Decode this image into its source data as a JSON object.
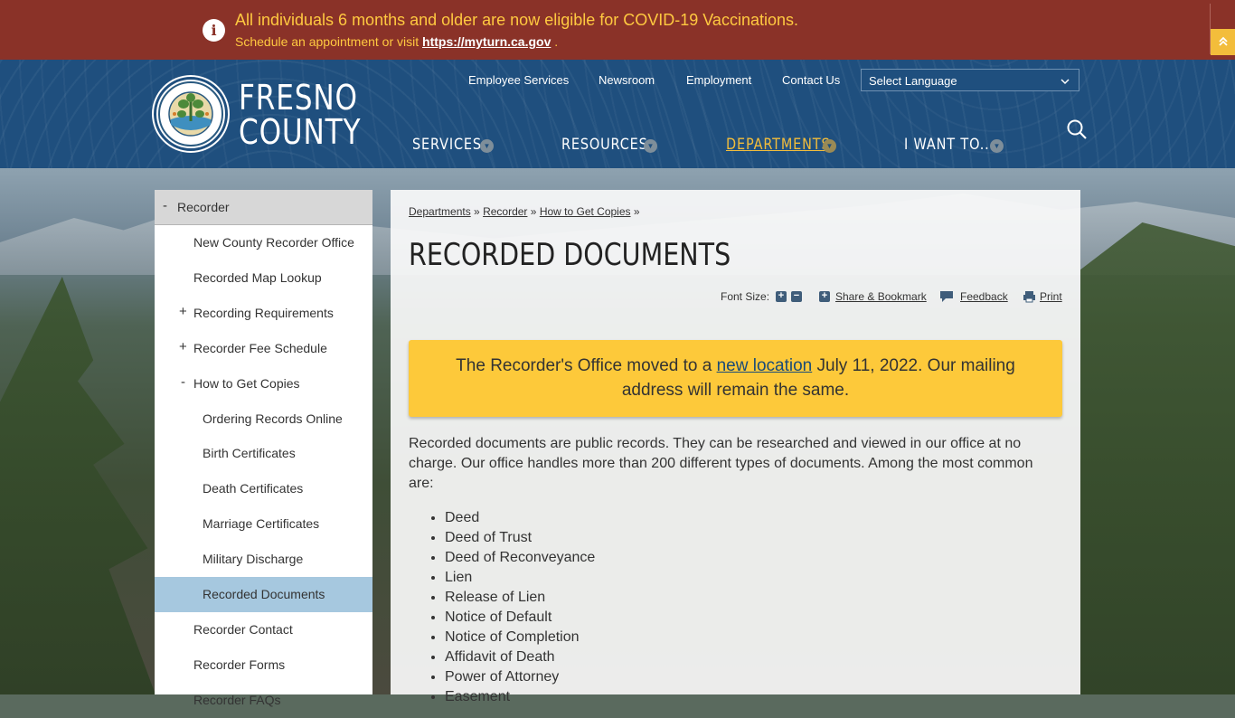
{
  "alert": {
    "icon": "info-icon",
    "title": "All individuals 6 months and older are now eligible for COVID-19 Vaccinations.",
    "sub_prefix": "Schedule an appointment or visit",
    "link": "https://myturn.ca.gov",
    "sub_suffix": "."
  },
  "header": {
    "brand_line1": "FRESNO",
    "brand_line2": "COUNTY",
    "utility_links": [
      "Employee Services",
      "Newsroom",
      "Employment",
      "Contact Us"
    ],
    "language_select": "Select Language",
    "nav": [
      {
        "label": "SERVICES",
        "active": false
      },
      {
        "label": "RESOURCES",
        "active": false
      },
      {
        "label": "DEPARTMENTS",
        "active": true
      },
      {
        "label": "I WANT TO...",
        "active": false
      }
    ]
  },
  "sidebar": {
    "head": {
      "toggle": "-",
      "label": "Recorder"
    },
    "items": [
      {
        "label": "New County Recorder Office",
        "toggle": "",
        "level": 1,
        "active": false
      },
      {
        "label": "Recorded Map Lookup",
        "toggle": "",
        "level": 1,
        "active": false
      },
      {
        "label": "Recording Requirements",
        "toggle": "+",
        "level": 1,
        "active": false
      },
      {
        "label": "Recorder Fee Schedule",
        "toggle": "+",
        "level": 1,
        "active": false
      },
      {
        "label": "How to Get Copies",
        "toggle": "-",
        "level": 1,
        "active": false
      },
      {
        "label": "Ordering Records Online",
        "toggle": "",
        "level": 2,
        "active": false
      },
      {
        "label": "Birth Certificates",
        "toggle": "",
        "level": 2,
        "active": false
      },
      {
        "label": "Death Certificates",
        "toggle": "",
        "level": 2,
        "active": false
      },
      {
        "label": "Marriage Certificates",
        "toggle": "",
        "level": 2,
        "active": false
      },
      {
        "label": "Military Discharge",
        "toggle": "",
        "level": 2,
        "active": false
      },
      {
        "label": "Recorded Documents",
        "toggle": "",
        "level": 2,
        "active": true
      },
      {
        "label": "Recorder Contact",
        "toggle": "",
        "level": 1,
        "active": false
      },
      {
        "label": "Recorder Forms",
        "toggle": "",
        "level": 1,
        "active": false
      },
      {
        "label": "Recorder FAQs",
        "toggle": "",
        "level": 1,
        "active": false
      }
    ]
  },
  "main": {
    "breadcrumbs": [
      "Departments",
      "Recorder",
      "How to Get Copies"
    ],
    "crumb_sep": "»",
    "title": "RECORDED DOCUMENTS",
    "tools": {
      "font_size_label": "Font Size:",
      "increase": "+",
      "decrease": "−",
      "share": "Share & Bookmark",
      "feedback": "Feedback",
      "print": "Print"
    },
    "notice": {
      "before": "The Recorder's Office moved to a",
      "link": "new location",
      "after": "July 11, 2022. Our mailing address will remain the same."
    },
    "intro": "Recorded documents are public records. They can be researched and viewed in our office at no charge. Our office handles more than 200 different types of documents. Among the most common are:",
    "documents": [
      "Deed",
      "Deed of Trust",
      "Deed of Reconveyance",
      "Lien",
      "Release of Lien",
      "Notice of Default",
      "Notice of Completion",
      "Affidavit of Death",
      "Power of Attorney",
      "Easement"
    ]
  },
  "colors": {
    "alert_bg": "#8a3228",
    "alert_text": "#ffc940",
    "header_bg": "#1f4f7e",
    "nav_active": "#f3bd3b",
    "sidebar_active": "#a6c8df",
    "notice_bg": "#fdc93a"
  }
}
